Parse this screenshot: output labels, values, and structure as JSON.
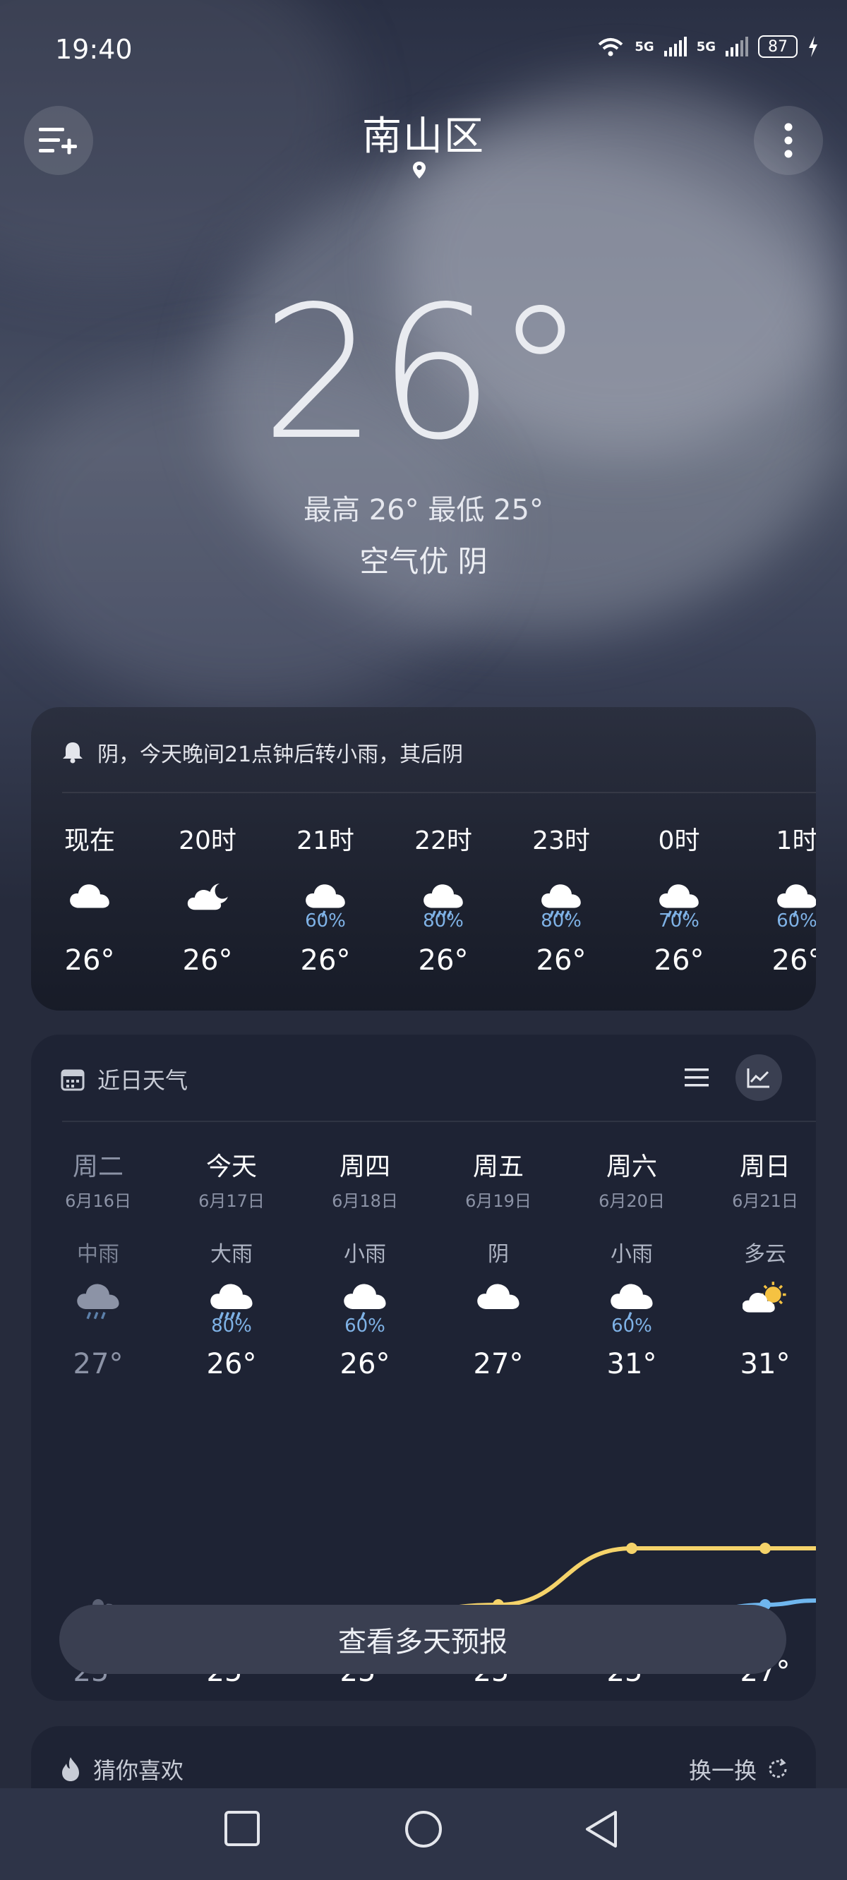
{
  "status": {
    "time": "19:40",
    "net1": "5G",
    "net2": "5G",
    "battery": "87"
  },
  "header": {
    "city": "南山区",
    "add_city_icon": "list-add-icon",
    "more_icon": "more-vertical-icon"
  },
  "current": {
    "temp": "26°",
    "hilo": "最高 26° 最低 25°",
    "condition": "空气优 阴"
  },
  "hourly": {
    "alert": "阴，今天晚间21点钟后转小雨，其后阴",
    "items": [
      {
        "label": "现在",
        "icon": "cloud-icon",
        "pct": "",
        "temp": "26°"
      },
      {
        "label": "20时",
        "icon": "cloud-moon-icon",
        "pct": "",
        "temp": "26°"
      },
      {
        "label": "21时",
        "icon": "light-rain-icon",
        "pct": "60%",
        "temp": "26°"
      },
      {
        "label": "22时",
        "icon": "heavy-rain-icon",
        "pct": "80%",
        "temp": "26°"
      },
      {
        "label": "23时",
        "icon": "heavy-rain-icon",
        "pct": "80%",
        "temp": "26°"
      },
      {
        "label": "0时",
        "icon": "heavy-rain-icon",
        "pct": "70%",
        "temp": "26°"
      },
      {
        "label": "1时",
        "icon": "light-rain-icon",
        "pct": "60%",
        "temp": "26°"
      }
    ]
  },
  "daily": {
    "title": "近日天气",
    "days": [
      {
        "name": "周二",
        "date": "6月16日",
        "weather": "中雨",
        "icon": "moderate-rain-icon",
        "pct": "",
        "hi": "27°",
        "lo": "25°",
        "hi_val": 27,
        "lo_val": 25,
        "past": true
      },
      {
        "name": "今天",
        "date": "6月17日",
        "weather": "大雨",
        "icon": "heavy-rain-icon",
        "pct": "80%",
        "hi": "26°",
        "lo": "25°",
        "hi_val": 26,
        "lo_val": 25,
        "past": false
      },
      {
        "name": "周四",
        "date": "6月18日",
        "weather": "小雨",
        "icon": "light-rain-icon",
        "pct": "60%",
        "hi": "26°",
        "lo": "25°",
        "hi_val": 26,
        "lo_val": 25,
        "past": false
      },
      {
        "name": "周五",
        "date": "6月19日",
        "weather": "阴",
        "icon": "cloud-icon",
        "pct": "",
        "hi": "27°",
        "lo": "25°",
        "hi_val": 27,
        "lo_val": 25,
        "past": false
      },
      {
        "name": "周六",
        "date": "6月20日",
        "weather": "小雨",
        "icon": "light-rain-icon",
        "pct": "60%",
        "hi": "31°",
        "lo": "25°",
        "hi_val": 31,
        "lo_val": 25,
        "past": false
      },
      {
        "name": "周日",
        "date": "6月21日",
        "weather": "多云",
        "icon": "partly-cloudy-icon",
        "pct": "",
        "hi": "31°",
        "lo": "27°",
        "hi_val": 31,
        "lo_val": 27,
        "past": false
      }
    ],
    "more_label": "查看多天预报",
    "hi_color": "#f5d36a",
    "lo_color": "#6fb6ee"
  },
  "recommend": {
    "title": "猜你喜欢",
    "refresh": "换一换"
  }
}
